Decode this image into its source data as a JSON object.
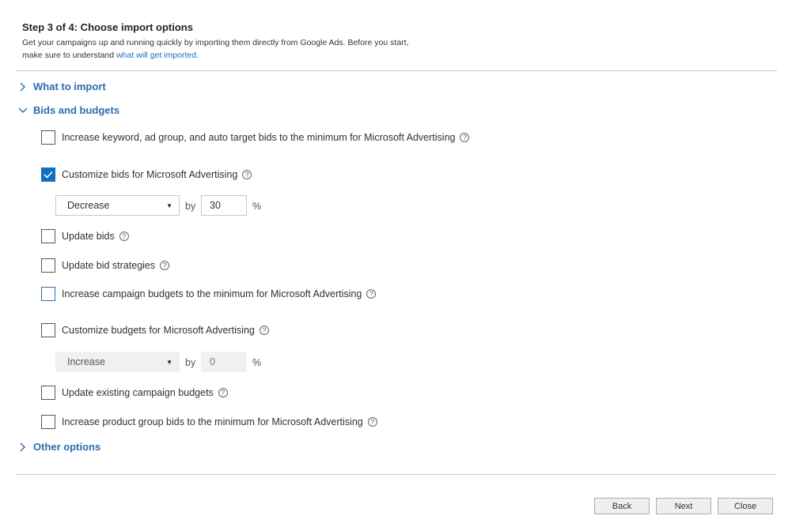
{
  "header": {
    "title": "Step 3 of 4: Choose import options",
    "description_line1": "Get your campaigns up and running quickly by importing them directly from Google Ads. Before you start,",
    "description_line2_prefix": "make sure to understand ",
    "description_link": "what will get imported",
    "description_line2_suffix": "."
  },
  "sections": {
    "what_to_import": "What to import",
    "bids_and_budgets": "Bids and budgets",
    "other_options": "Other options"
  },
  "options": {
    "increase_bids_min": {
      "label": "Increase keyword, ad group, and auto target bids to the minimum for Microsoft Advertising",
      "checked": false
    },
    "customize_bids": {
      "label": "Customize bids for Microsoft Advertising",
      "checked": true
    },
    "update_bids": {
      "label": "Update bids",
      "checked": false
    },
    "update_bid_strategies": {
      "label": "Update bid strategies",
      "checked": false
    },
    "increase_budgets_min": {
      "label": "Increase campaign budgets to the minimum for Microsoft Advertising",
      "checked": false
    },
    "customize_budgets": {
      "label": "Customize budgets for Microsoft Advertising",
      "checked": false
    },
    "update_existing_budgets": {
      "label": "Update existing campaign budgets",
      "checked": false
    },
    "increase_product_group_bids": {
      "label": "Increase product group bids to the minimum for Microsoft Advertising",
      "checked": false
    }
  },
  "bid_adjust": {
    "direction": "Decrease",
    "by": "by",
    "value": "30",
    "unit": "%"
  },
  "budget_adjust": {
    "direction": "Increase",
    "by": "by",
    "value": "0",
    "unit": "%"
  },
  "buttons": {
    "back": "Back",
    "next": "Next",
    "close": "Close"
  },
  "icons": {
    "help": "question-circle-icon",
    "check": "checkmark-icon",
    "collapsed": "chevron-right-icon",
    "expanded": "chevron-down-icon",
    "dropdown": "caret-down-icon"
  },
  "colors": {
    "accent": "#106ebe",
    "link": "#2b6cb0"
  }
}
